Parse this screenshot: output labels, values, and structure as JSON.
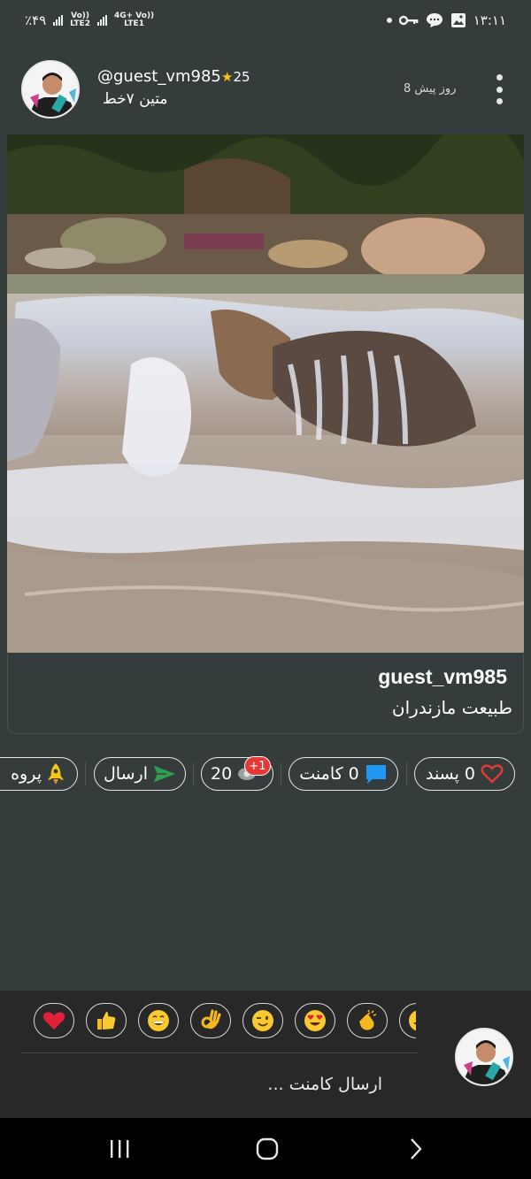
{
  "status_bar": {
    "time": "۱۳:۱۱",
    "battery": "٪۴۹",
    "sim1_label_top": "Vo))",
    "sim1_label_bottom": "LTE2",
    "sim2_label_top": "4G+ Vo))",
    "sim2_label_bottom": "LTE1",
    "icons": [
      "dot-icon",
      "key-icon",
      "chat-icon",
      "gallery-icon"
    ]
  },
  "post": {
    "username": "@guest_vm985",
    "star_count": "25",
    "font_name": "متین ۷خط",
    "time_ago": "8 روز پیش",
    "caption_username": "guest_vm985",
    "caption_text": "طبیعت مازندران"
  },
  "actions": {
    "like_count": "0",
    "like_label": "پسند",
    "comment_count": "0",
    "comment_label": "کامنت",
    "views_count": "20",
    "views_badge": "+1",
    "send_label": "ارسال",
    "promote_label": "پروه"
  },
  "emojis": [
    "❤️",
    "👍",
    "😄",
    "👌",
    "😉",
    "😍",
    "👏",
    "😂"
  ],
  "comment": {
    "placeholder": "ارسال کامنت ..."
  },
  "colors": {
    "background": "#353c3c",
    "comment_bar": "#282828",
    "heart": "#e53935",
    "comment_icon": "#2196f3",
    "send_icon": "#2e9e4f",
    "rocket": "#f5c518",
    "badge": "#e53935"
  }
}
